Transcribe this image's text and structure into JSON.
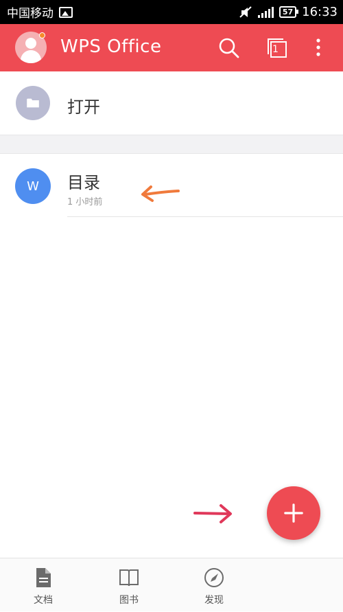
{
  "status_bar": {
    "carrier": "中国移动",
    "battery": "57",
    "time": "16:33"
  },
  "app_bar": {
    "title": "WPS Office",
    "open_tabs_count": "1"
  },
  "open_row": {
    "label": "打开"
  },
  "recent_files": [
    {
      "name": "目录",
      "time": "1 小时前",
      "type_letter": "W"
    }
  ],
  "bottom_nav": {
    "items": [
      {
        "label": "文档",
        "icon": "document-icon"
      },
      {
        "label": "图书",
        "icon": "book-icon"
      },
      {
        "label": "发现",
        "icon": "compass-icon"
      }
    ]
  },
  "colors": {
    "brand_red": "#ee4b53",
    "writer_blue": "#4f8ef0",
    "folder_gray": "#b9bbd2",
    "annotation_orange": "#f07a3c",
    "annotation_red": "#e0385a"
  }
}
